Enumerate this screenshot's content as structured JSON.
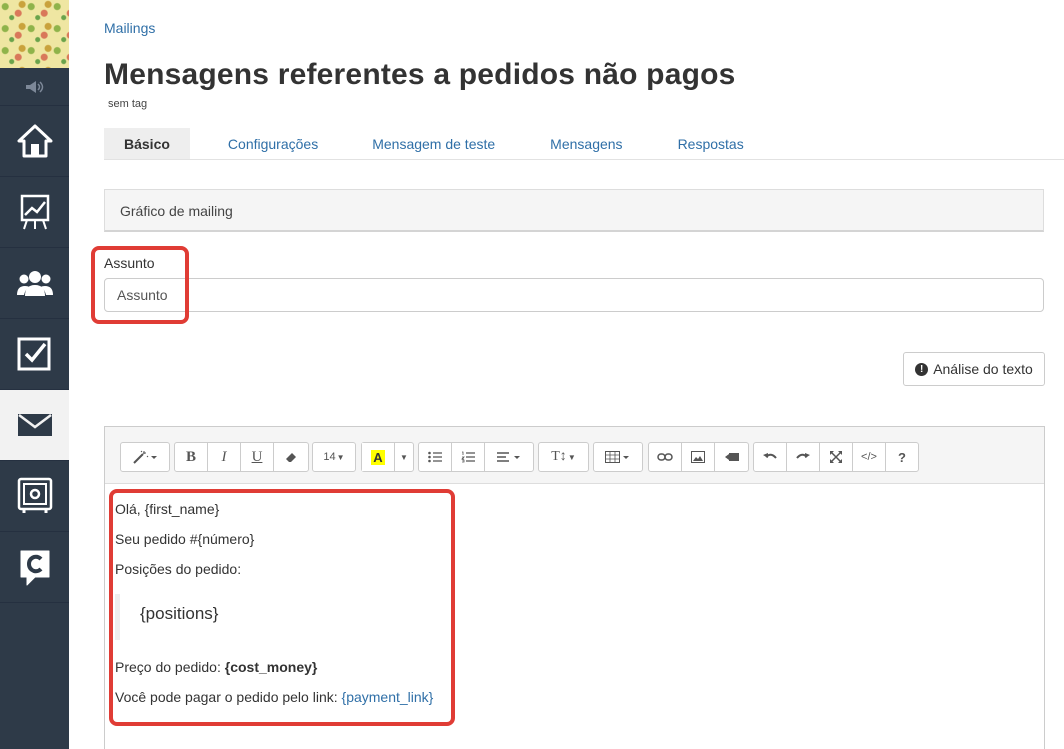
{
  "sidebar": {
    "items": [
      {
        "name": "home",
        "icon": "home-icon"
      },
      {
        "name": "stats",
        "icon": "chart-board-icon"
      },
      {
        "name": "users",
        "icon": "users-icon"
      },
      {
        "name": "tasks",
        "icon": "checkbox-icon"
      },
      {
        "name": "mailings",
        "icon": "envelope-icon",
        "active": true
      },
      {
        "name": "safe",
        "icon": "safe-icon"
      },
      {
        "name": "chat",
        "icon": "chat-c-icon"
      }
    ]
  },
  "header": {
    "breadcrumb": "Mailings",
    "title": "Mensagens referentes a pedidos não pagos",
    "tag": "sem tag"
  },
  "tabs": [
    {
      "label": "Básico",
      "active": true
    },
    {
      "label": "Configurações"
    },
    {
      "label": "Mensagem de teste"
    },
    {
      "label": "Mensagens"
    },
    {
      "label": "Respostas"
    }
  ],
  "panel": {
    "title": "Gráfico de mailing"
  },
  "subject": {
    "label": "Assunto",
    "placeholder": "Assunto"
  },
  "analysis_button": {
    "label": "Análise do texto"
  },
  "toolbar": {
    "font_size": "14",
    "bold": "B",
    "italic": "I",
    "underline": "U",
    "highlight": "A",
    "help": "?"
  },
  "content": {
    "greeting": "Olá, {first_name}",
    "order_line": "Seu pedido #{número}",
    "positions_label": "Posições do pedido:",
    "positions_var": "{positions}",
    "price_label": "Preço do pedido: ",
    "price_var": "{cost_money}",
    "pay_label": "Você pode pagar o pedido pelo link: ",
    "pay_link": "{payment_link}"
  },
  "colors": {
    "sidebar": "#2e3a48",
    "link": "#2f6fa7",
    "highlight_border": "#e03c35"
  }
}
